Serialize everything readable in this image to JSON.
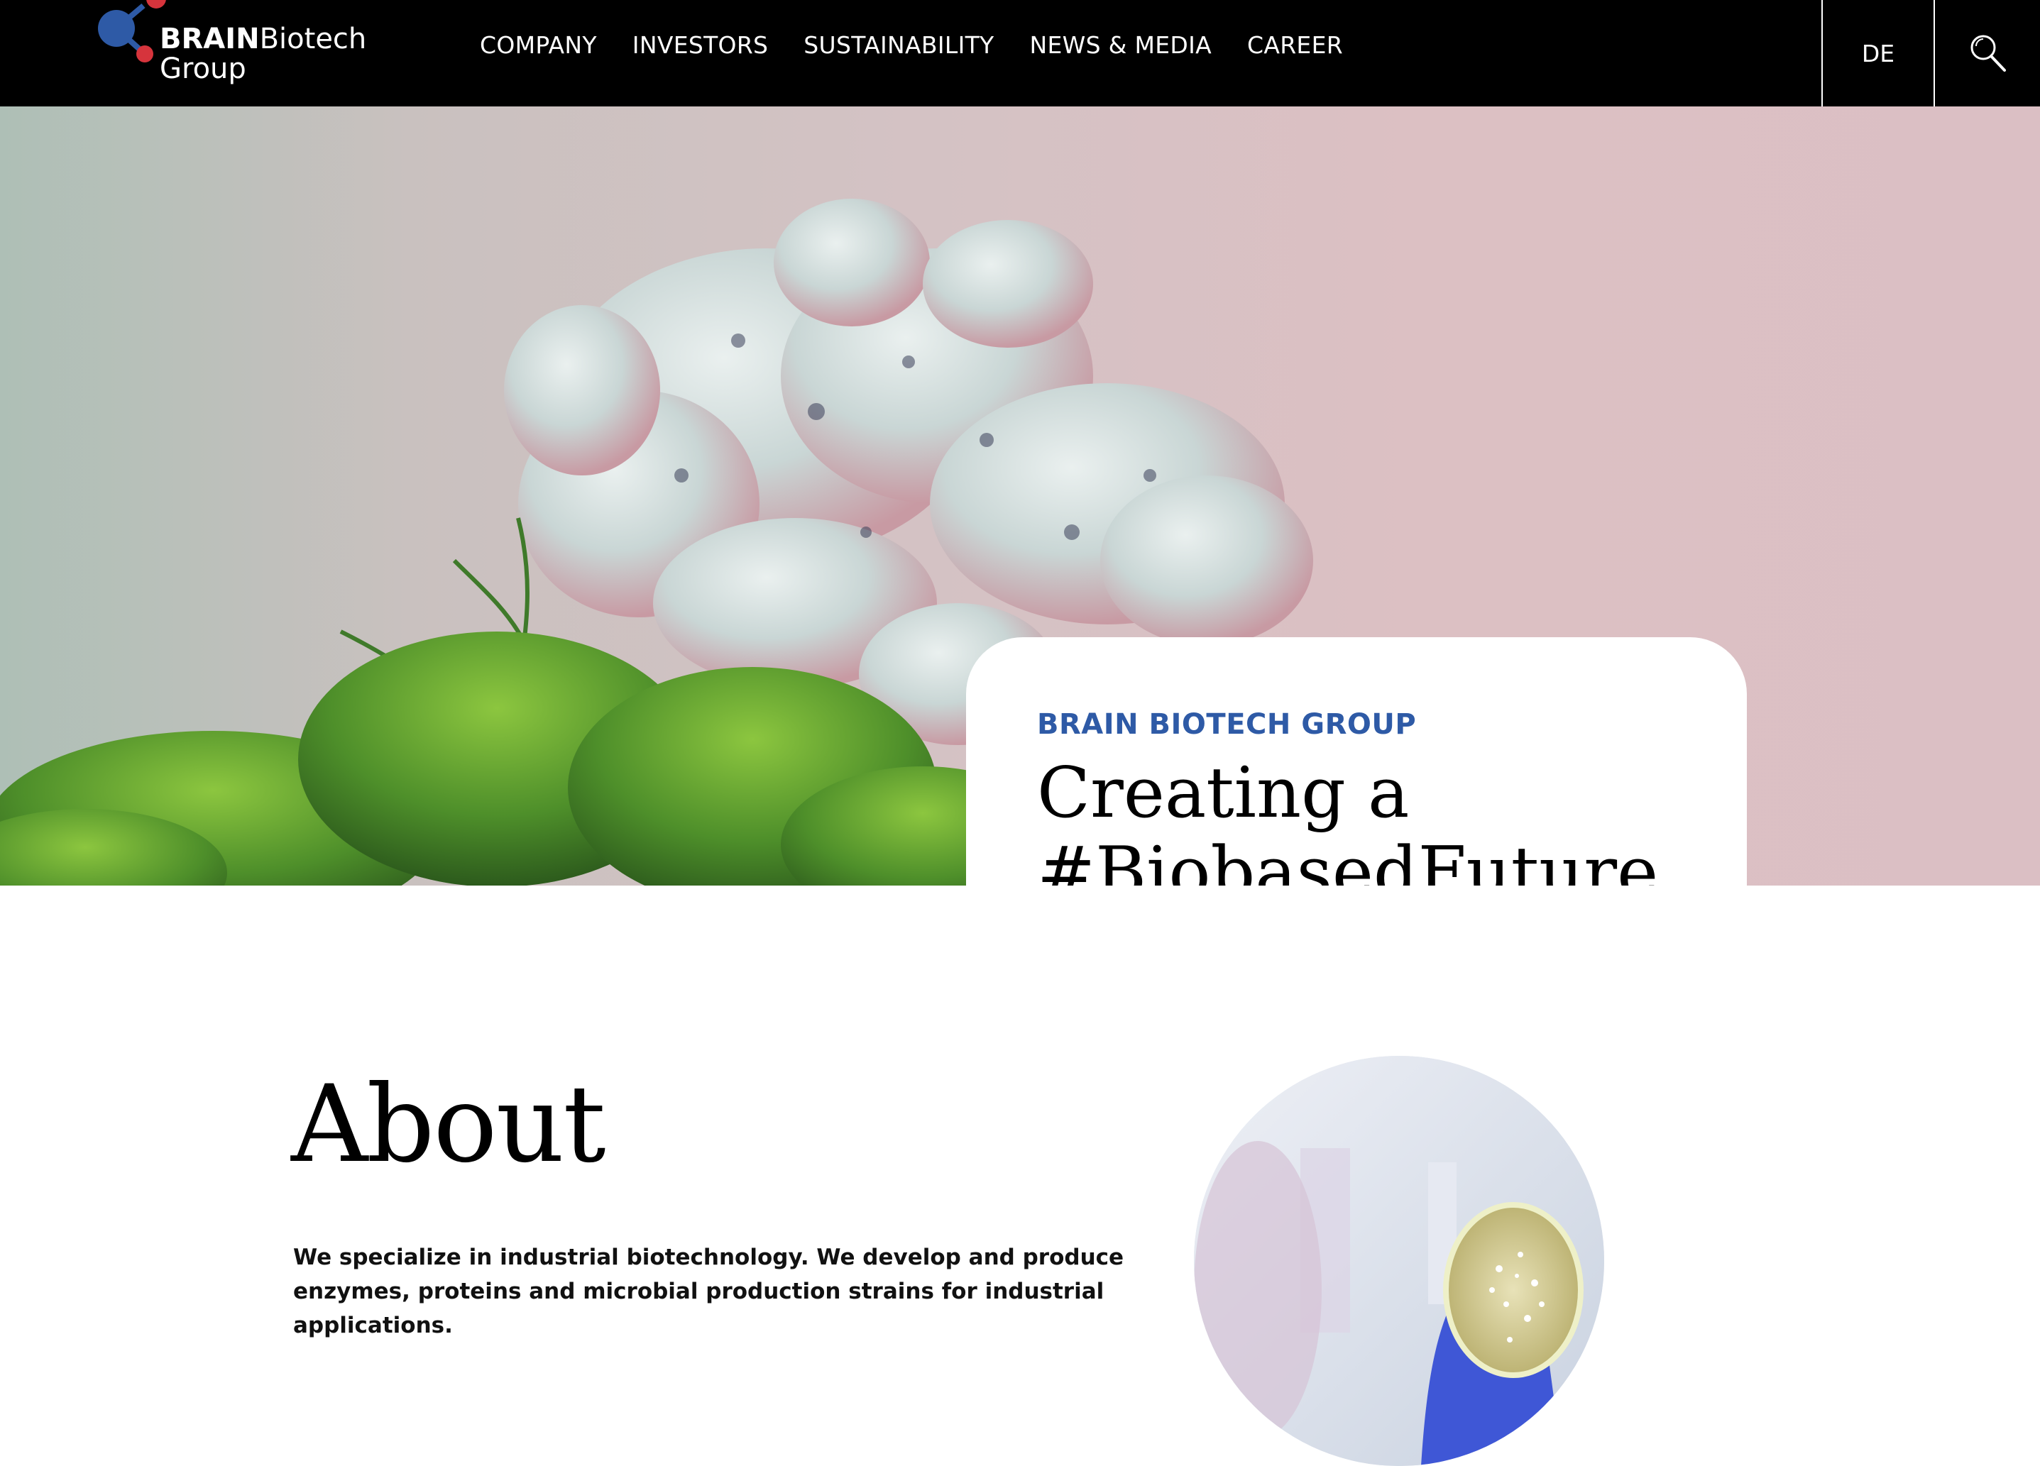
{
  "header": {
    "logo": {
      "brand_bold": "BRAIN",
      "brand_rest": "Biotech",
      "brand_line2": "Group",
      "icon": "molecule-logo-icon"
    },
    "nav": [
      {
        "label": "COMPANY"
      },
      {
        "label": "INVESTORS"
      },
      {
        "label": "SUSTAINABILITY"
      },
      {
        "label": "NEWS & MEDIA"
      },
      {
        "label": "CAREER"
      }
    ],
    "language": "DE",
    "search_icon": "search-icon"
  },
  "hero": {
    "eyebrow": "BRAIN BIOTECH GROUP",
    "title": "Creating a\n#BiobasedFuture",
    "image": "protein-coral-on-moss-image"
  },
  "about": {
    "title": "About",
    "text": "We specialize in industrial biotechnology. We develop and produce enzymes, proteins and microbial production strains for industrial applications.",
    "image": "petri-dish-lab-image"
  },
  "colors": {
    "header_bg": "#000000",
    "accent_blue": "#2e5aa6",
    "logo_red": "#d6343c",
    "logo_blue": "#2e5aa6"
  }
}
